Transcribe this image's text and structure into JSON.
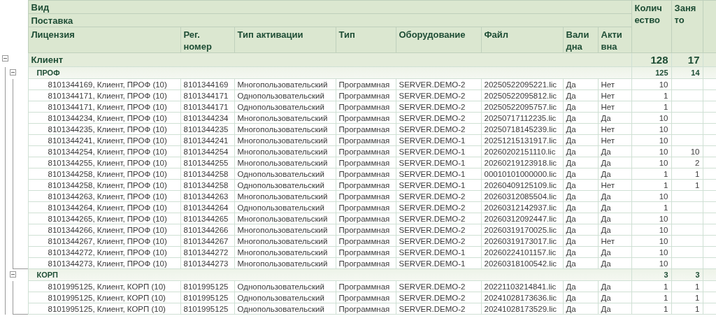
{
  "columns": {
    "view": "Вид",
    "supply": "Поставка",
    "license": "Лицензия",
    "reg": "Рег. номер",
    "activation": "Тип активации",
    "type": "Тип",
    "equipment": "Оборудование",
    "file": "Файл",
    "valid": "Валидна",
    "active": "Активна",
    "quantity": "Количество",
    "occupied": "Занято"
  },
  "groups": [
    {
      "name": "Клиент",
      "expanded": true,
      "quantity": "128",
      "occupied": "17",
      "children": [
        {
          "name": "ПРОФ",
          "expanded": true,
          "quantity": "125",
          "occupied": "14",
          "rows": [
            {
              "license": "8101344169, Клиент, ПРОФ (10)",
              "reg": "8101344169",
              "activation": "Многопользовательский",
              "type": "Программная",
              "equipment": "SERVER.DEMO-2",
              "file": "20250522095221.lic",
              "valid": "Да",
              "active": "Нет",
              "quantity": "10"
            },
            {
              "license": "8101344171, Клиент, ПРОФ (10)",
              "reg": "8101344171",
              "activation": "Однопользовательский",
              "type": "Программная",
              "equipment": "SERVER.DEMO-2",
              "file": "20250522095812.lic",
              "valid": "Да",
              "active": "Нет",
              "quantity": "1"
            },
            {
              "license": "8101344171, Клиент, ПРОФ (10)",
              "reg": "8101344171",
              "activation": "Однопользовательский",
              "type": "Программная",
              "equipment": "SERVER.DEMO-2",
              "file": "20250522095757.lic",
              "valid": "Да",
              "active": "Нет",
              "quantity": "1"
            },
            {
              "license": "8101344234, Клиент, ПРОФ (10)",
              "reg": "8101344234",
              "activation": "Многопользовательский",
              "type": "Программная",
              "equipment": "SERVER.DEMO-2",
              "file": "20250717112235.lic",
              "valid": "Да",
              "active": "Да",
              "quantity": "10"
            },
            {
              "license": "8101344235, Клиент, ПРОФ (10)",
              "reg": "8101344235",
              "activation": "Многопользовательский",
              "type": "Программная",
              "equipment": "SERVER.DEMO-2",
              "file": "20250718145239.lic",
              "valid": "Да",
              "active": "Нет",
              "quantity": "10"
            },
            {
              "license": "8101344241, Клиент, ПРОФ (10)",
              "reg": "8101344241",
              "activation": "Многопользовательский",
              "type": "Программная",
              "equipment": "SERVER.DEMO-1",
              "file": "20251215131917.lic",
              "valid": "Да",
              "active": "Нет",
              "quantity": "10"
            },
            {
              "license": "8101344254, Клиент, ПРОФ (10)",
              "reg": "8101344254",
              "activation": "Многопользовательский",
              "type": "Программная",
              "equipment": "SERVER.DEMO-1",
              "file": "20260202151110.lic",
              "valid": "Да",
              "active": "Да",
              "quantity": "10",
              "occupied": "10"
            },
            {
              "license": "8101344255, Клиент, ПРОФ (10)",
              "reg": "8101344255",
              "activation": "Многопользовательский",
              "type": "Программная",
              "equipment": "SERVER.DEMO-1",
              "file": "20260219123918.lic",
              "valid": "Да",
              "active": "Да",
              "quantity": "10",
              "occupied": "2"
            },
            {
              "license": "8101344258, Клиент, ПРОФ (10)",
              "reg": "8101344258",
              "activation": "Однопользовательский",
              "type": "Программная",
              "equipment": "SERVER.DEMO-1",
              "file": "00010101000000.lic",
              "valid": "Да",
              "active": "Да",
              "quantity": "1",
              "occupied": "1"
            },
            {
              "license": "8101344258, Клиент, ПРОФ (10)",
              "reg": "8101344258",
              "activation": "Однопользовательский",
              "type": "Программная",
              "equipment": "SERVER.DEMO-1",
              "file": "20260409125109.lic",
              "valid": "Да",
              "active": "Нет",
              "quantity": "1",
              "occupied": "1"
            },
            {
              "license": "8101344263, Клиент, ПРОФ (10)",
              "reg": "8101344263",
              "activation": "Многопользовательский",
              "type": "Программная",
              "equipment": "SERVER.DEMO-2",
              "file": "20260312085504.lic",
              "valid": "Да",
              "active": "Да",
              "quantity": "10"
            },
            {
              "license": "8101344264, Клиент, ПРОФ (10)",
              "reg": "8101344264",
              "activation": "Однопользовательский",
              "type": "Программная",
              "equipment": "SERVER.DEMO-2",
              "file": "20260312142937.lic",
              "valid": "Да",
              "active": "Да",
              "quantity": "1"
            },
            {
              "license": "8101344265, Клиент, ПРОФ (10)",
              "reg": "8101344265",
              "activation": "Многопользовательский",
              "type": "Программная",
              "equipment": "SERVER.DEMO-2",
              "file": "20260312092447.lic",
              "valid": "Да",
              "active": "Да",
              "quantity": "10"
            },
            {
              "license": "8101344266, Клиент, ПРОФ (10)",
              "reg": "8101344266",
              "activation": "Многопользовательский",
              "type": "Программная",
              "equipment": "SERVER.DEMO-2",
              "file": "20260319170025.lic",
              "valid": "Да",
              "active": "Да",
              "quantity": "10"
            },
            {
              "license": "8101344267, Клиент, ПРОФ (10)",
              "reg": "8101344267",
              "activation": "Многопользовательский",
              "type": "Программная",
              "equipment": "SERVER.DEMO-2",
              "file": "20260319173017.lic",
              "valid": "Да",
              "active": "Нет",
              "quantity": "10"
            },
            {
              "license": "8101344272, Клиент, ПРОФ (10)",
              "reg": "8101344272",
              "activation": "Многопользовательский",
              "type": "Программная",
              "equipment": "SERVER.DEMO-1",
              "file": "20260224101157.lic",
              "valid": "Да",
              "active": "Да",
              "quantity": "10"
            },
            {
              "license": "8101344273, Клиент, ПРОФ (10)",
              "reg": "8101344273",
              "activation": "Многопользовательский",
              "type": "Программная",
              "equipment": "SERVER.DEMO-1",
              "file": "20260318100542.lic",
              "valid": "Да",
              "active": "Да",
              "quantity": "10"
            }
          ]
        },
        {
          "name": "КОРП",
          "expanded": true,
          "quantity": "3",
          "occupied": "3",
          "rows": [
            {
              "license": "8101995125, Клиент, КОРП (10)",
              "reg": "8101995125",
              "activation": "Однопользовательский",
              "type": "Программная",
              "equipment": "SERVER.DEMO-2",
              "file": "20221103214841.lic",
              "valid": "Да",
              "active": "Да",
              "quantity": "1",
              "occupied": "1"
            },
            {
              "license": "8101995125, Клиент, КОРП (10)",
              "reg": "8101995125",
              "activation": "Однопользовательский",
              "type": "Программная",
              "equipment": "SERVER.DEMO-2",
              "file": "20241028173636.lic",
              "valid": "Да",
              "active": "Да",
              "quantity": "1",
              "occupied": "1"
            },
            {
              "license": "8101995125, Клиент, КОРП (10)",
              "reg": "8101995125",
              "activation": "Однопользовательский",
              "type": "Программная",
              "equipment": "SERVER.DEMO-2",
              "file": "20241028173529.lic",
              "valid": "Да",
              "active": "Да",
              "quantity": "1",
              "occupied": "1"
            }
          ]
        }
      ]
    }
  ]
}
